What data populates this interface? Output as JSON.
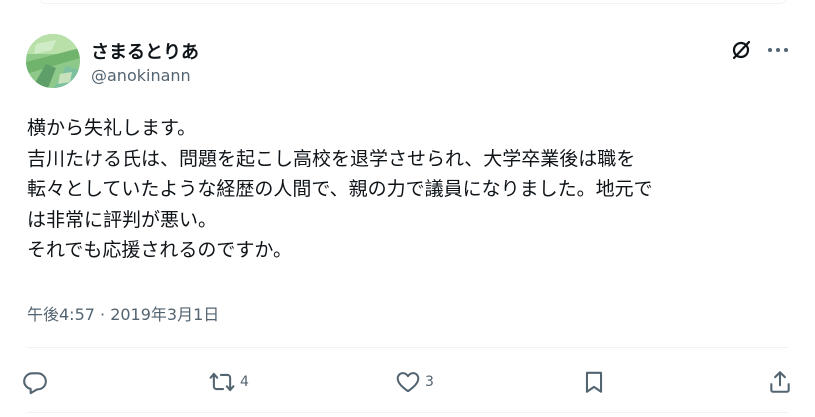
{
  "user": {
    "display_name": "さまるとりあ",
    "handle": "@anokinann"
  },
  "tweet": {
    "lines": [
      "横から失礼します。",
      "吉川たける氏は、問題を起こし高校を退学させられ、大学卒業後は職を",
      "転々としていたような経歴の人間で、親の力で議員になりました。地元で",
      "は非常に評判が悪い。",
      "それでも応援されるのですか。"
    ],
    "timestamp": "午後4:57 · 2019年3月1日"
  },
  "actions": {
    "reply_count": "",
    "retweet_count": "4",
    "like_count": "3"
  },
  "icons": {
    "grok": "grok-icon",
    "more": "more-icon",
    "reply": "reply-icon",
    "retweet": "retweet-icon",
    "like": "heart-icon",
    "bookmark": "bookmark-icon",
    "share": "share-icon"
  },
  "colors": {
    "text": "#0f1419",
    "secondary": "#536471",
    "divider": "#eff3f4"
  }
}
